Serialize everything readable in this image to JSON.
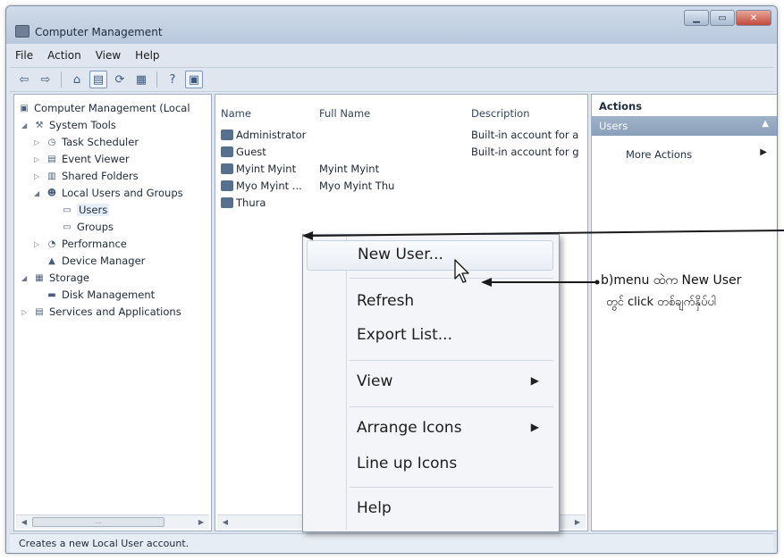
{
  "window": {
    "title": "Computer Management",
    "controls": [
      "▁",
      "▭",
      "✕"
    ]
  },
  "menubar": {
    "items": [
      "File",
      "Action",
      "View",
      "Help"
    ]
  },
  "toolbar": {
    "icons": [
      "back-arrow-icon",
      "forward-arrow-icon",
      "up-folder-icon",
      "show-hide-tree-icon",
      "refresh-icon",
      "export-list-icon",
      "help-icon",
      "properties-icon"
    ]
  },
  "tree": {
    "items": [
      {
        "label": "Computer Management (Local"
      },
      {
        "label": "System Tools"
      },
      {
        "label": "Task Scheduler"
      },
      {
        "label": "Event Viewer"
      },
      {
        "label": "Shared Folders"
      },
      {
        "label": "Local Users and Groups"
      },
      {
        "label": "Users"
      },
      {
        "label": "Groups"
      },
      {
        "label": "Performance"
      },
      {
        "label": "Device Manager"
      },
      {
        "label": "Storage"
      },
      {
        "label": "Disk Management"
      },
      {
        "label": "Services and Applications"
      }
    ]
  },
  "list": {
    "columns": [
      "Name",
      "Full Name",
      "Description"
    ],
    "rows": [
      {
        "name": "Administrator",
        "full_name": "",
        "description": "Built-in account for a"
      },
      {
        "name": "Guest",
        "full_name": "",
        "description": "Built-in account for g"
      },
      {
        "name": "Myint Myint",
        "full_name": "Myint Myint",
        "description": ""
      },
      {
        "name": "Myo Myint ...",
        "full_name": "Myo Myint Thu",
        "description": ""
      },
      {
        "name": "Thura",
        "full_name": "",
        "description": ""
      }
    ]
  },
  "actions": {
    "header": "Actions",
    "section": "Users",
    "link": "More Actions"
  },
  "context_menu": {
    "items": [
      "New User...",
      "Refresh",
      "Export List...",
      "View",
      "Arrange Icons",
      "Line up Icons",
      "Help"
    ]
  },
  "annotation": {
    "line1": "b)menu ထဲက New User",
    "line2": "တွင် click တစ်ချက်နှိပ်ပါ"
  },
  "statusbar": {
    "text": "Creates a new Local User account."
  },
  "scrollbar": {
    "thumb_label": "..."
  }
}
